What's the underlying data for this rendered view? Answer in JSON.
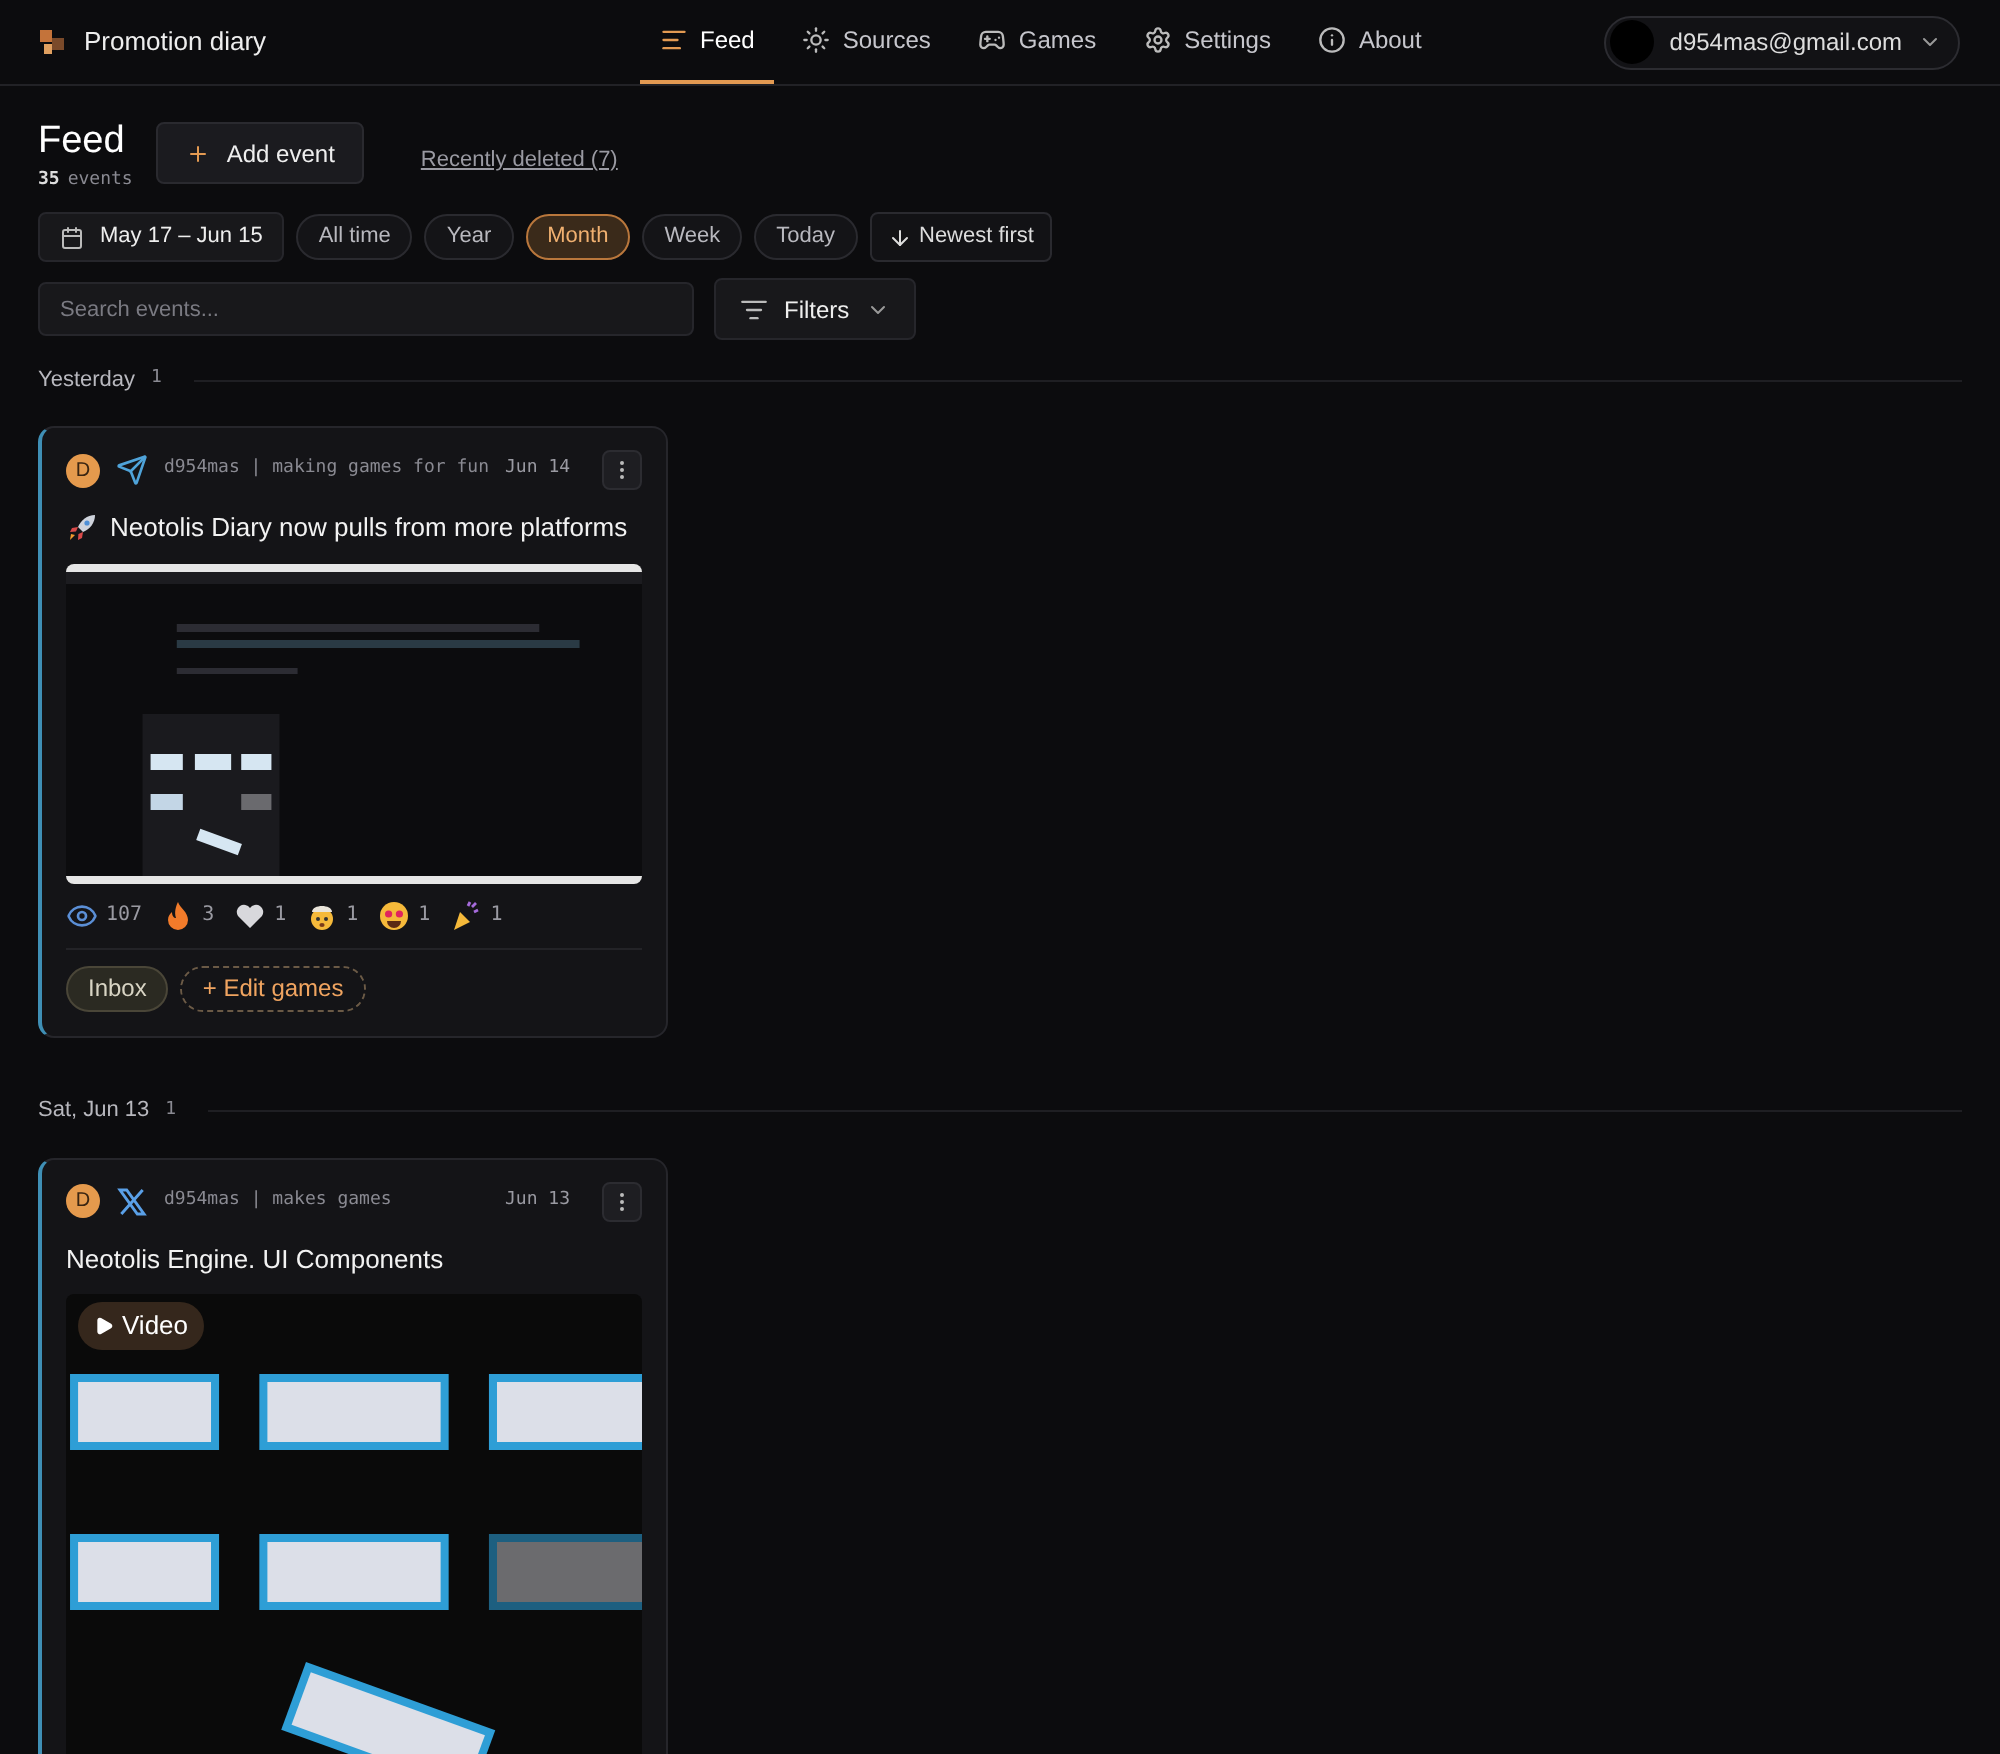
{
  "header": {
    "brand": "Promotion diary",
    "nav": [
      {
        "label": "Feed",
        "kind": "feed",
        "selected": true
      },
      {
        "label": "Sources",
        "kind": "sources",
        "selected": false
      },
      {
        "label": "Games",
        "kind": "games",
        "selected": false
      },
      {
        "label": "Settings",
        "kind": "settings",
        "selected": false
      },
      {
        "label": "About",
        "kind": "about",
        "selected": false
      }
    ],
    "account": "d954mas@gmail.com"
  },
  "toolbar": {
    "title": "Feed",
    "count": "35",
    "count_unit": "events",
    "add_event": "Add event",
    "recently_deleted": "Recently deleted (7)",
    "date_range": "May 17 – Jun 15",
    "ranges": [
      {
        "label": "All time",
        "selected": false
      },
      {
        "label": "Year",
        "selected": false
      },
      {
        "label": "Month",
        "selected": true
      },
      {
        "label": "Week",
        "selected": false
      },
      {
        "label": "Today",
        "selected": false
      }
    ],
    "sort": "Newest first",
    "search": {
      "placeholder": "Search events..."
    },
    "filters": "Filters"
  },
  "groups": [
    {
      "label": "Yesterday",
      "count": "1",
      "events": [
        {
          "initial": "D",
          "source": {
            "kind": "telegram",
            "handle": "d954mas | making games for fun"
          },
          "date": "Jun 14",
          "title": {
            "kind": "rocket",
            "text": "Neotolis Diary now pulls from more platforms"
          },
          "reactions": [
            {
              "kind": "views",
              "count": "107"
            },
            {
              "kind": "fire",
              "count": "3"
            },
            {
              "kind": "heart",
              "count": "1"
            },
            {
              "kind": "mindblown",
              "count": "1"
            },
            {
              "kind": "starstruck",
              "count": "1"
            },
            {
              "kind": "party",
              "count": "1"
            }
          ],
          "tags": [
            {
              "kind": "status",
              "label": "Inbox"
            },
            {
              "kind": "add",
              "label": "+ Edit games"
            }
          ]
        }
      ]
    },
    {
      "label": "Sat, Jun 13",
      "count": "1",
      "events": [
        {
          "initial": "D",
          "source": {
            "kind": "x",
            "handle": "d954mas | makes games"
          },
          "date": "Jun 13",
          "title": {
            "kind": "plain",
            "text": "Neotolis Engine. UI Components"
          },
          "media": {
            "kind": "video",
            "badge": "Video"
          }
        }
      ]
    }
  ]
}
